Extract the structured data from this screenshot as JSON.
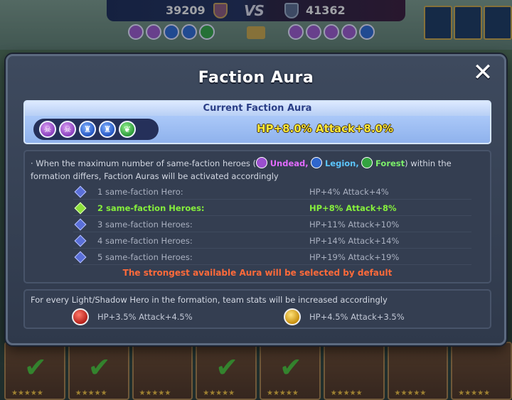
{
  "hud": {
    "left_score": "39209",
    "vs_label": "VS",
    "right_score": "41362"
  },
  "modal": {
    "title": "Faction Aura",
    "close_glyph": "✕",
    "current": {
      "heading": "Current Faction Aura",
      "icons": [
        "undead-icon",
        "undead-icon",
        "legion-icon",
        "legion-icon",
        "forest-icon"
      ],
      "stats": "HP+8.0% Attack+8.0%"
    },
    "rules": {
      "desc_prefix": "· When the maximum number of same-faction heroes (",
      "undead_label": "Undead,",
      "legion_label": "Legion,",
      "forest_label": "Forest",
      "desc_suffix": ") within the formation differs, Faction Auras will be activated accordingly",
      "tiers": [
        {
          "name": "1 same-faction Hero:",
          "stat": "HP+4% Attack+4%"
        },
        {
          "name": "2 same-faction Heroes:",
          "stat": "HP+8% Attack+8%"
        },
        {
          "name": "3 same-faction Heroes:",
          "stat": "HP+11% Attack+10%"
        },
        {
          "name": "4 same-faction Heroes:",
          "stat": "HP+14% Attack+14%"
        },
        {
          "name": "5 same-faction Heroes:",
          "stat": "HP+19% Attack+19%"
        }
      ],
      "active_tier": 2,
      "note": "The strongest available Aura will be selected by default"
    },
    "light_shadow": {
      "desc": "For every Light/Shadow Hero in the formation, team stats will be increased accordingly",
      "shadow_stat": "HP+3.5% Attack+4.5%",
      "light_stat": "HP+4.5% Attack+3.5%"
    }
  },
  "colors": {
    "active_tier": "#86f03c",
    "note": "#ff6a3a",
    "current_stats": "#ffea3a",
    "undead": "#e26bff",
    "legion": "#5cc6ff",
    "forest": "#7cf06a"
  }
}
